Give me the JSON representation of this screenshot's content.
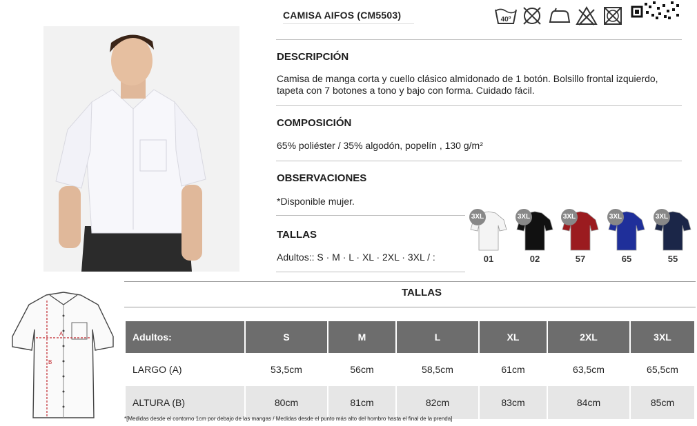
{
  "product": {
    "title": "CAMISA AIFOS (CM5503)"
  },
  "care_icons": [
    "wash-40-icon",
    "no-bleach-icon",
    "iron-icon",
    "no-tumble-dry-icon",
    "no-dry-clean-icon",
    "qr-code-icon"
  ],
  "care_wash_temp": "40º",
  "sections": {
    "descripcion": {
      "heading": "DESCRIPCIÓN",
      "line1": "Camisa de manga corta y cuello clásico almidonado de 1 botón. Bolsillo frontal izquierdo,",
      "line2": "tapeta con 7 botones a tono y bajo con forma. Cuidado fácil."
    },
    "composicion": {
      "heading": "COMPOSICIÓN",
      "text": "65% poliéster / 35% algodón, popelín , 130 g/m²"
    },
    "observaciones": {
      "heading": "OBSERVACIONES",
      "text": "*Disponible mujer."
    },
    "tallas": {
      "heading": "TALLAS",
      "text": "Adultos:: S · M · L · XL · 2XL · 3XL / :"
    }
  },
  "colors": [
    {
      "code": "01",
      "badge": "3XL",
      "hex": "#f4f4f4"
    },
    {
      "code": "02",
      "badge": "3XL",
      "hex": "#111111"
    },
    {
      "code": "57",
      "badge": "3XL",
      "hex": "#9b1b1f"
    },
    {
      "code": "65",
      "badge": "3XL",
      "hex": "#1f2f9a"
    },
    {
      "code": "55",
      "badge": "3XL",
      "hex": "#1b2648"
    }
  ],
  "size_table": {
    "title": "TALLAS",
    "header": [
      "Adultos:",
      "S",
      "M",
      "L",
      "XL",
      "2XL",
      "3XL"
    ],
    "rows": [
      [
        "LARGO (A)",
        "53,5cm",
        "56cm",
        "58,5cm",
        "61cm",
        "63,5cm",
        "65,5cm"
      ],
      [
        "ALTURA (B)",
        "80cm",
        "81cm",
        "82cm",
        "83cm",
        "84cm",
        "85cm"
      ]
    ],
    "footnote": "*[Medidas desde el contorno 1cm por debajo de las mangas / Medidas desde el punto más alto del hombro hasta el final de la prenda]"
  },
  "diagram": {
    "label_a": "A",
    "label_b": "B"
  }
}
